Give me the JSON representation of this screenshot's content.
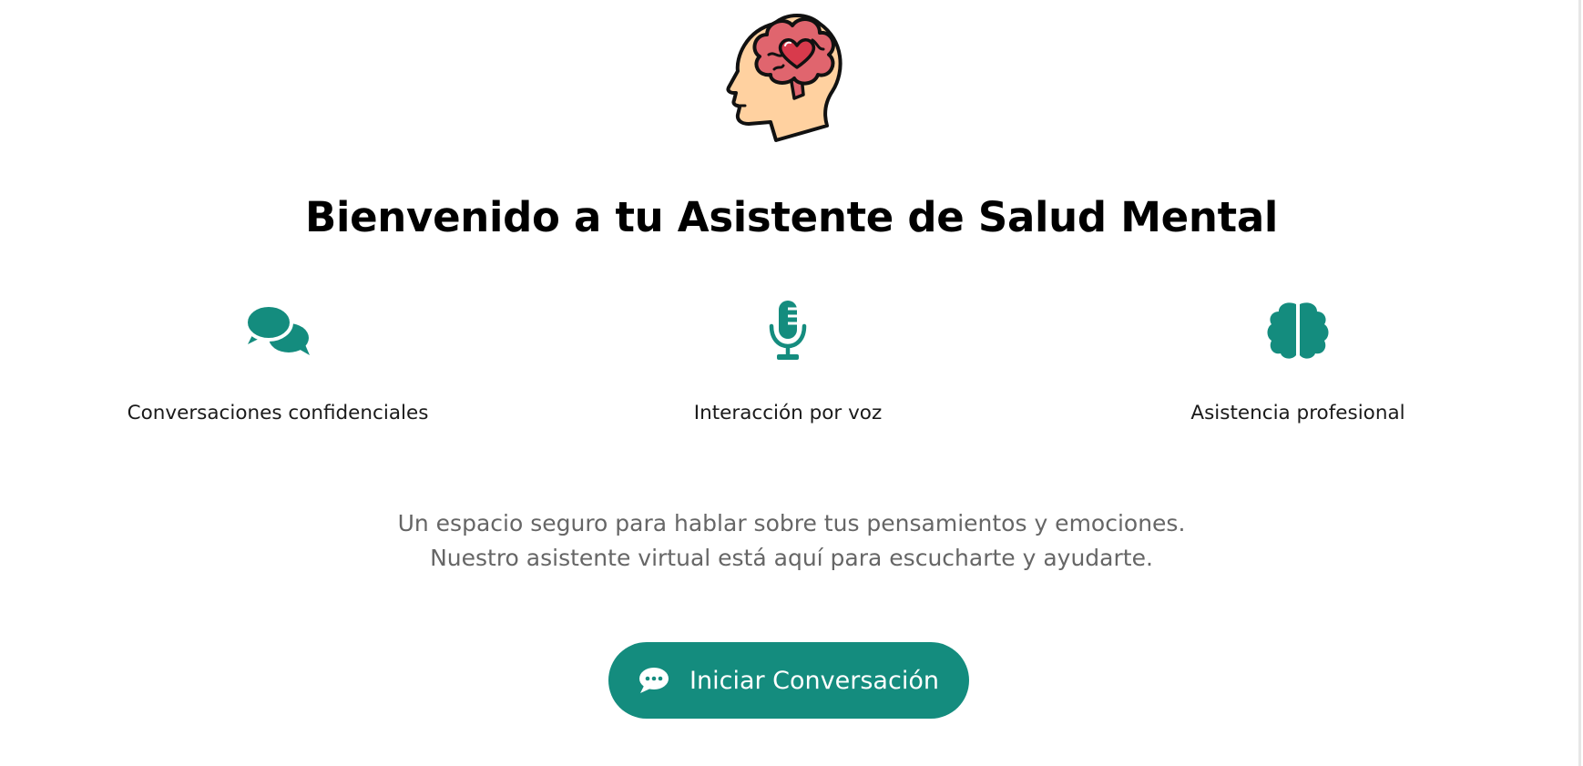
{
  "header": {
    "logo_icon": "head-brain-heart-icon",
    "title": "Bienvenido a tu Asistente de Salud Mental"
  },
  "features": [
    {
      "icon": "chat-bubbles-icon",
      "label": "Conversaciones confidenciales"
    },
    {
      "icon": "microphone-icon",
      "label": "Interacción por voz"
    },
    {
      "icon": "brain-icon",
      "label": "Asistencia profesional"
    }
  ],
  "description": {
    "line1": "Un espacio seguro para hablar sobre tus pensamientos y emociones.",
    "line2": "Nuestro asistente virtual está aquí para escucharte y ayudarte."
  },
  "cta": {
    "icon": "comment-dots-icon",
    "label": "Iniciar Conversación"
  },
  "colors": {
    "accent": "#148c7e",
    "title": "#000000",
    "body_text": "#666666",
    "head_skin": "#ffd1a0",
    "brain_pink": "#e0656e",
    "heart_red": "#d83a4c"
  }
}
